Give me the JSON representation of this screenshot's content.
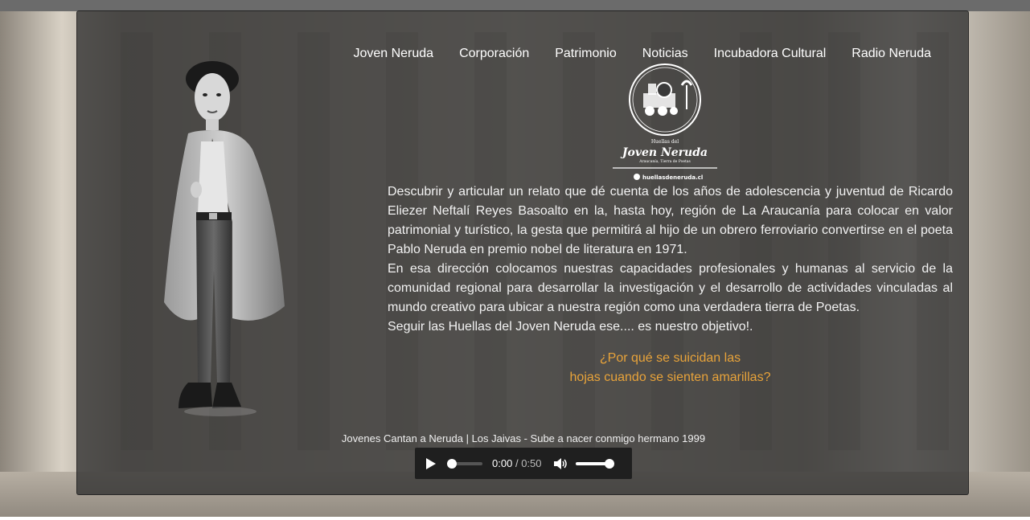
{
  "nav": {
    "items": [
      {
        "label": "Joven Neruda"
      },
      {
        "label": "Corporación"
      },
      {
        "label": "Patrimonio"
      },
      {
        "label": "Noticias"
      },
      {
        "label": "Incubadora Cultural"
      },
      {
        "label": "Radio Neruda"
      }
    ]
  },
  "logo": {
    "line1": "Huellas del",
    "line2": "Joven Neruda",
    "line3": "Araucanía, Tierra de Poetas",
    "site": "huellasdeneruda.cl"
  },
  "content": {
    "paragraph1": "Descubrir y articular un relato que dé cuenta de los años de adolescencia y juventud de Ricardo Eliezer Neftalí Reyes Basoalto en la, hasta hoy, región de La Araucanía para colocar en valor patrimonial y turístico, la gesta que permitirá al hijo de un obrero ferroviario convertirse en el poeta Pablo Neruda en premio nobel de literatura en 1971.",
    "paragraph2": "En esa dirección colocamos nuestras capacidades profesionales y humanas al servicio de la comunidad regional para desarrollar la investigación y el desarrollo de actividades vinculadas al mundo creativo para ubicar a nuestra región como una verdadera tierra de Poetas.",
    "paragraph3": "Seguir las Huellas del Joven Neruda ese.... es nuestro objetivo!.",
    "quote_line1": "¿Por qué se suicidan las",
    "quote_line2": "hojas cuando se sienten amarillas?"
  },
  "audio": {
    "title": "Jovenes Cantan a Neruda | Los Jaivas - Sube a nacer conmigo hermano 1999",
    "current_time": "0:00",
    "separator": "/",
    "duration": "0:50",
    "progress": 0,
    "volume": 1
  },
  "colors": {
    "accent": "#e8a33a",
    "panel": "#303030",
    "text": "#f2f2f2"
  }
}
